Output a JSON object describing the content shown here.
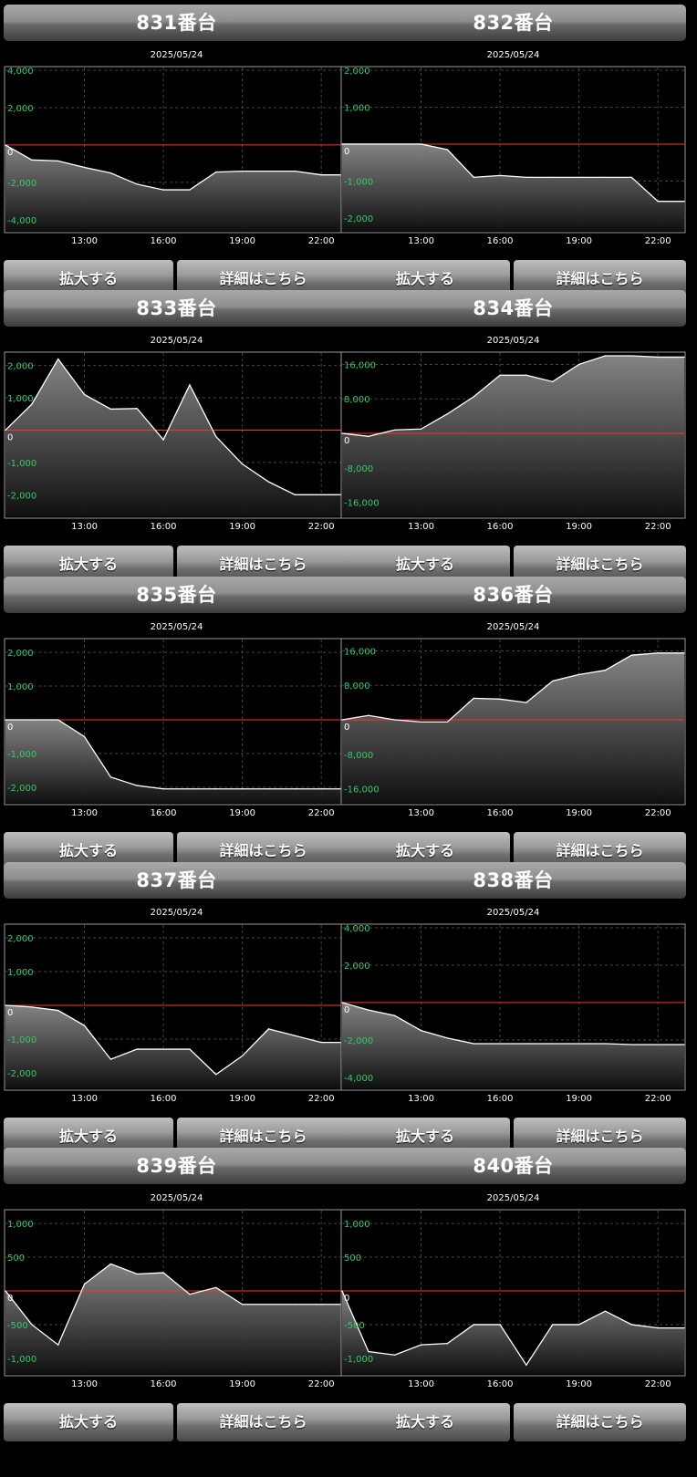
{
  "zoom_label": "拡大する",
  "detail_label": "詳細はこちら",
  "colors": {
    "tick_label": "#33cc66",
    "zero_line": "#ff3030",
    "series": "#ffffff",
    "axis_text": "#ffffff"
  },
  "machines": [
    {
      "title": "831番台",
      "date": "2025/05/24",
      "chart_data": {
        "type": "area",
        "x": [
          "10:00",
          "11:00",
          "12:00",
          "13:00",
          "14:00",
          "15:00",
          "16:00",
          "17:00",
          "18:00",
          "19:00",
          "20:00",
          "21:00",
          "22:00",
          "23:00"
        ],
        "x_ticks": [
          "13:00",
          "16:00",
          "19:00",
          "22:00"
        ],
        "y_ticks": [
          "4,000",
          "2,000",
          "0",
          "-2,000",
          "-4,000"
        ],
        "ylim": [
          -4300,
          4000
        ],
        "values": [
          0,
          -800,
          -850,
          -1200,
          -1500,
          -2100,
          -2400,
          -2400,
          -1450,
          -1400,
          -1400,
          -1400,
          -1600,
          -1600
        ],
        "grid": true
      }
    },
    {
      "title": "832番台",
      "date": "2025/05/24",
      "chart_data": {
        "type": "area",
        "x": [
          "10:00",
          "11:00",
          "12:00",
          "13:00",
          "14:00",
          "15:00",
          "16:00",
          "17:00",
          "18:00",
          "19:00",
          "20:00",
          "21:00",
          "22:00",
          "23:00"
        ],
        "x_ticks": [
          "13:00",
          "16:00",
          "19:00",
          "22:00"
        ],
        "y_ticks": [
          "2,000",
          "1,000",
          "0",
          "-1,000",
          "-2,000"
        ],
        "ylim": [
          -2200,
          2000
        ],
        "values": [
          0,
          0,
          0,
          0,
          -150,
          -900,
          -850,
          -900,
          -900,
          -900,
          -900,
          -900,
          -1550,
          -1550
        ],
        "grid": true
      }
    },
    {
      "title": "833番台",
      "date": "2025/05/24",
      "chart_data": {
        "type": "area",
        "x": [
          "10:00",
          "11:00",
          "12:00",
          "13:00",
          "14:00",
          "15:00",
          "16:00",
          "17:00",
          "18:00",
          "19:00",
          "20:00",
          "21:00",
          "22:00",
          "23:00"
        ],
        "x_ticks": [
          "13:00",
          "16:00",
          "19:00",
          "22:00"
        ],
        "y_ticks": [
          "2,000",
          "1,000",
          "0",
          "-1,000",
          "-2,000"
        ],
        "ylim": [
          -2500,
          2300
        ],
        "values": [
          0,
          800,
          2200,
          1100,
          650,
          670,
          -300,
          1400,
          -200,
          -1050,
          -1600,
          -2000,
          -2000,
          -2000
        ],
        "grid": true
      }
    },
    {
      "title": "834番台",
      "date": "2025/05/24",
      "chart_data": {
        "type": "area",
        "x": [
          "10:00",
          "11:00",
          "12:00",
          "13:00",
          "14:00",
          "15:00",
          "16:00",
          "17:00",
          "18:00",
          "19:00",
          "20:00",
          "21:00",
          "22:00",
          "23:00"
        ],
        "x_ticks": [
          "13:00",
          "16:00",
          "19:00",
          "22:00"
        ],
        "y_ticks": [
          "16,000",
          "8,000",
          "0",
          "-8,000",
          "-16,000"
        ],
        "ylim": [
          -18000,
          18000
        ],
        "values": [
          0,
          -700,
          800,
          1000,
          4500,
          8500,
          13500,
          13500,
          12000,
          16000,
          18000,
          18000,
          17700,
          17700
        ],
        "grid": true
      }
    },
    {
      "title": "835番台",
      "date": "2025/05/24",
      "chart_data": {
        "type": "area",
        "x": [
          "10:00",
          "11:00",
          "12:00",
          "13:00",
          "14:00",
          "15:00",
          "16:00",
          "17:00",
          "18:00",
          "19:00",
          "20:00",
          "21:00",
          "22:00",
          "23:00"
        ],
        "x_ticks": [
          "13:00",
          "16:00",
          "19:00",
          "22:00"
        ],
        "y_ticks": [
          "2,000",
          "1,000",
          "0",
          "-1,000",
          "-2,000"
        ],
        "ylim": [
          -2300,
          2300
        ],
        "values": [
          0,
          0,
          0,
          -500,
          -1700,
          -1950,
          -2050,
          -2050,
          -2050,
          -2050,
          -2050,
          -2050,
          -2050,
          -2050
        ],
        "grid": true
      }
    },
    {
      "title": "836番台",
      "date": "2025/05/24",
      "chart_data": {
        "type": "area",
        "x": [
          "10:00",
          "11:00",
          "12:00",
          "13:00",
          "14:00",
          "15:00",
          "16:00",
          "17:00",
          "18:00",
          "19:00",
          "20:00",
          "21:00",
          "22:00",
          "23:00"
        ],
        "x_ticks": [
          "13:00",
          "16:00",
          "19:00",
          "22:00"
        ],
        "y_ticks": [
          "16,000",
          "8,000",
          "0",
          "-8,000",
          "-16,000"
        ],
        "ylim": [
          -18000,
          18000
        ],
        "values": [
          0,
          1000,
          0,
          -500,
          -500,
          5000,
          4800,
          4000,
          9000,
          10500,
          11500,
          15000,
          15500,
          15500
        ],
        "grid": true
      }
    },
    {
      "title": "837番台",
      "date": "2025/05/24",
      "chart_data": {
        "type": "area",
        "x": [
          "10:00",
          "11:00",
          "12:00",
          "13:00",
          "14:00",
          "15:00",
          "16:00",
          "17:00",
          "18:00",
          "19:00",
          "20:00",
          "21:00",
          "22:00",
          "23:00"
        ],
        "x_ticks": [
          "13:00",
          "16:00",
          "19:00",
          "22:00"
        ],
        "y_ticks": [
          "2,000",
          "1,000",
          "0",
          "-1,000",
          "-2,000"
        ],
        "ylim": [
          -2300,
          2300
        ],
        "values": [
          0,
          -50,
          -150,
          -600,
          -1600,
          -1300,
          -1300,
          -1300,
          -2050,
          -1500,
          -700,
          -900,
          -1100,
          -1100
        ],
        "grid": true
      }
    },
    {
      "title": "838番台",
      "date": "2025/05/24",
      "chart_data": {
        "type": "area",
        "x": [
          "10:00",
          "11:00",
          "12:00",
          "13:00",
          "14:00",
          "15:00",
          "16:00",
          "17:00",
          "18:00",
          "19:00",
          "20:00",
          "21:00",
          "22:00",
          "23:00"
        ],
        "x_ticks": [
          "13:00",
          "16:00",
          "19:00",
          "22:00"
        ],
        "y_ticks": [
          "4,000",
          "2,000",
          "0",
          "-2,000",
          "-4,000"
        ],
        "ylim": [
          -4300,
          4000
        ],
        "values": [
          0,
          -400,
          -700,
          -1500,
          -1900,
          -2200,
          -2200,
          -2200,
          -2200,
          -2200,
          -2200,
          -2250,
          -2250,
          -2250
        ],
        "grid": true
      }
    },
    {
      "title": "839番台",
      "date": "2025/05/24",
      "chart_data": {
        "type": "area",
        "x": [
          "10:00",
          "11:00",
          "12:00",
          "13:00",
          "14:00",
          "15:00",
          "16:00",
          "17:00",
          "18:00",
          "19:00",
          "20:00",
          "21:00",
          "22:00",
          "23:00"
        ],
        "x_ticks": [
          "13:00",
          "16:00",
          "19:00",
          "22:00"
        ],
        "y_ticks": [
          "1,000",
          "500",
          "0",
          "-500",
          "-1,000"
        ],
        "ylim": [
          -1150,
          1150
        ],
        "values": [
          0,
          -500,
          -800,
          100,
          400,
          250,
          270,
          -50,
          50,
          -200,
          -200,
          -200,
          -200,
          -200
        ],
        "grid": true
      }
    },
    {
      "title": "840番台",
      "date": "2025/05/24",
      "chart_data": {
        "type": "area",
        "x": [
          "10:00",
          "11:00",
          "12:00",
          "13:00",
          "14:00",
          "15:00",
          "16:00",
          "17:00",
          "18:00",
          "19:00",
          "20:00",
          "21:00",
          "22:00",
          "23:00"
        ],
        "x_ticks": [
          "13:00",
          "16:00",
          "19:00",
          "22:00"
        ],
        "y_ticks": [
          "1,000",
          "500",
          "0",
          "-500",
          "-1,000"
        ],
        "ylim": [
          -1150,
          1150
        ],
        "values": [
          0,
          -900,
          -950,
          -800,
          -780,
          -500,
          -500,
          -1100,
          -500,
          -500,
          -300,
          -500,
          -550,
          -550
        ],
        "grid": true
      }
    }
  ]
}
